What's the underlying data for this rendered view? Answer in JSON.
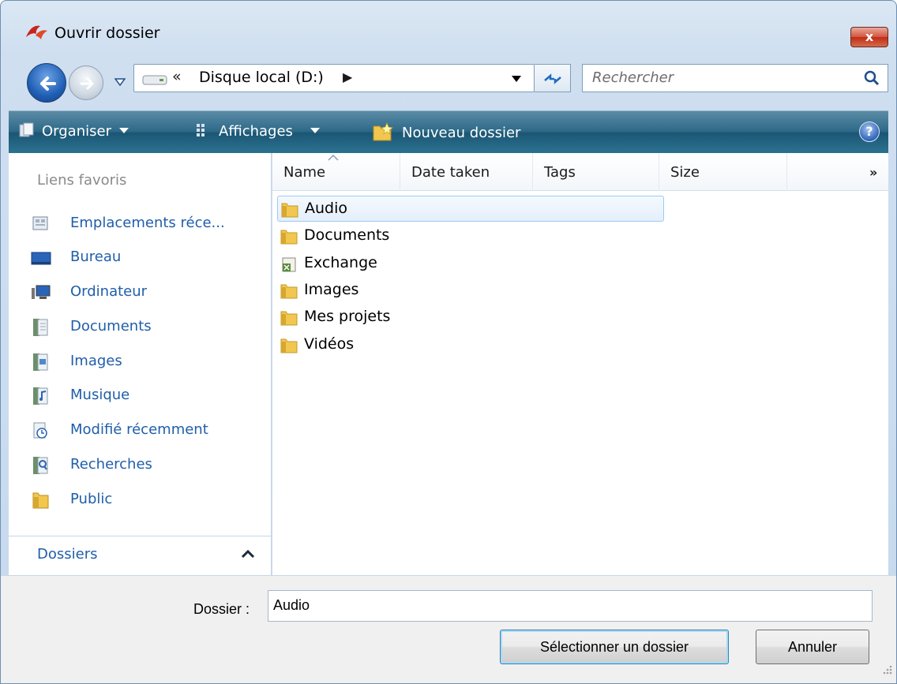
{
  "window": {
    "title": "Ouvrir dossier",
    "close_label": "x"
  },
  "nav": {
    "address": "Disque local (D:)",
    "address_prefix": "«",
    "address_arrow": "▶",
    "search_placeholder": "Rechercher"
  },
  "commandbar": {
    "organize": "Organiser",
    "views": "Affichages",
    "new_folder": "Nouveau dossier",
    "help": "?"
  },
  "navpane": {
    "header": "Liens favoris",
    "items": [
      {
        "label": "Emplacements réce...",
        "icon": "recent-places-icon"
      },
      {
        "label": "Bureau",
        "icon": "desktop-icon"
      },
      {
        "label": "Ordinateur",
        "icon": "computer-icon"
      },
      {
        "label": "Documents",
        "icon": "documents-icon"
      },
      {
        "label": "Images",
        "icon": "pictures-icon"
      },
      {
        "label": "Musique",
        "icon": "music-icon"
      },
      {
        "label": "Modifié récemment",
        "icon": "recently-changed-icon"
      },
      {
        "label": "Recherches",
        "icon": "searches-icon"
      },
      {
        "label": "Public",
        "icon": "public-folder-icon"
      }
    ],
    "folders_label": "Dossiers"
  },
  "columns": [
    "Name",
    "Date taken",
    "Tags",
    "Size"
  ],
  "more_columns": "»",
  "files": [
    {
      "name": "Audio",
      "icon": "folder-icon",
      "selected": true
    },
    {
      "name": "Documents",
      "icon": "folder-icon"
    },
    {
      "name": "Exchange",
      "icon": "exchange-file-icon"
    },
    {
      "name": "Images",
      "icon": "folder-icon"
    },
    {
      "name": "Mes projets",
      "icon": "folder-icon"
    },
    {
      "name": "Vidéos",
      "icon": "folder-icon"
    }
  ],
  "bottom": {
    "folder_label": "Dossier :",
    "folder_value": "Audio",
    "select_button": "Sélectionner un dossier",
    "cancel_button": "Annuler"
  },
  "colors": {
    "link": "#1f5eaa",
    "commandbar": "#1b5674",
    "selection_border": "#9ccbf0"
  }
}
